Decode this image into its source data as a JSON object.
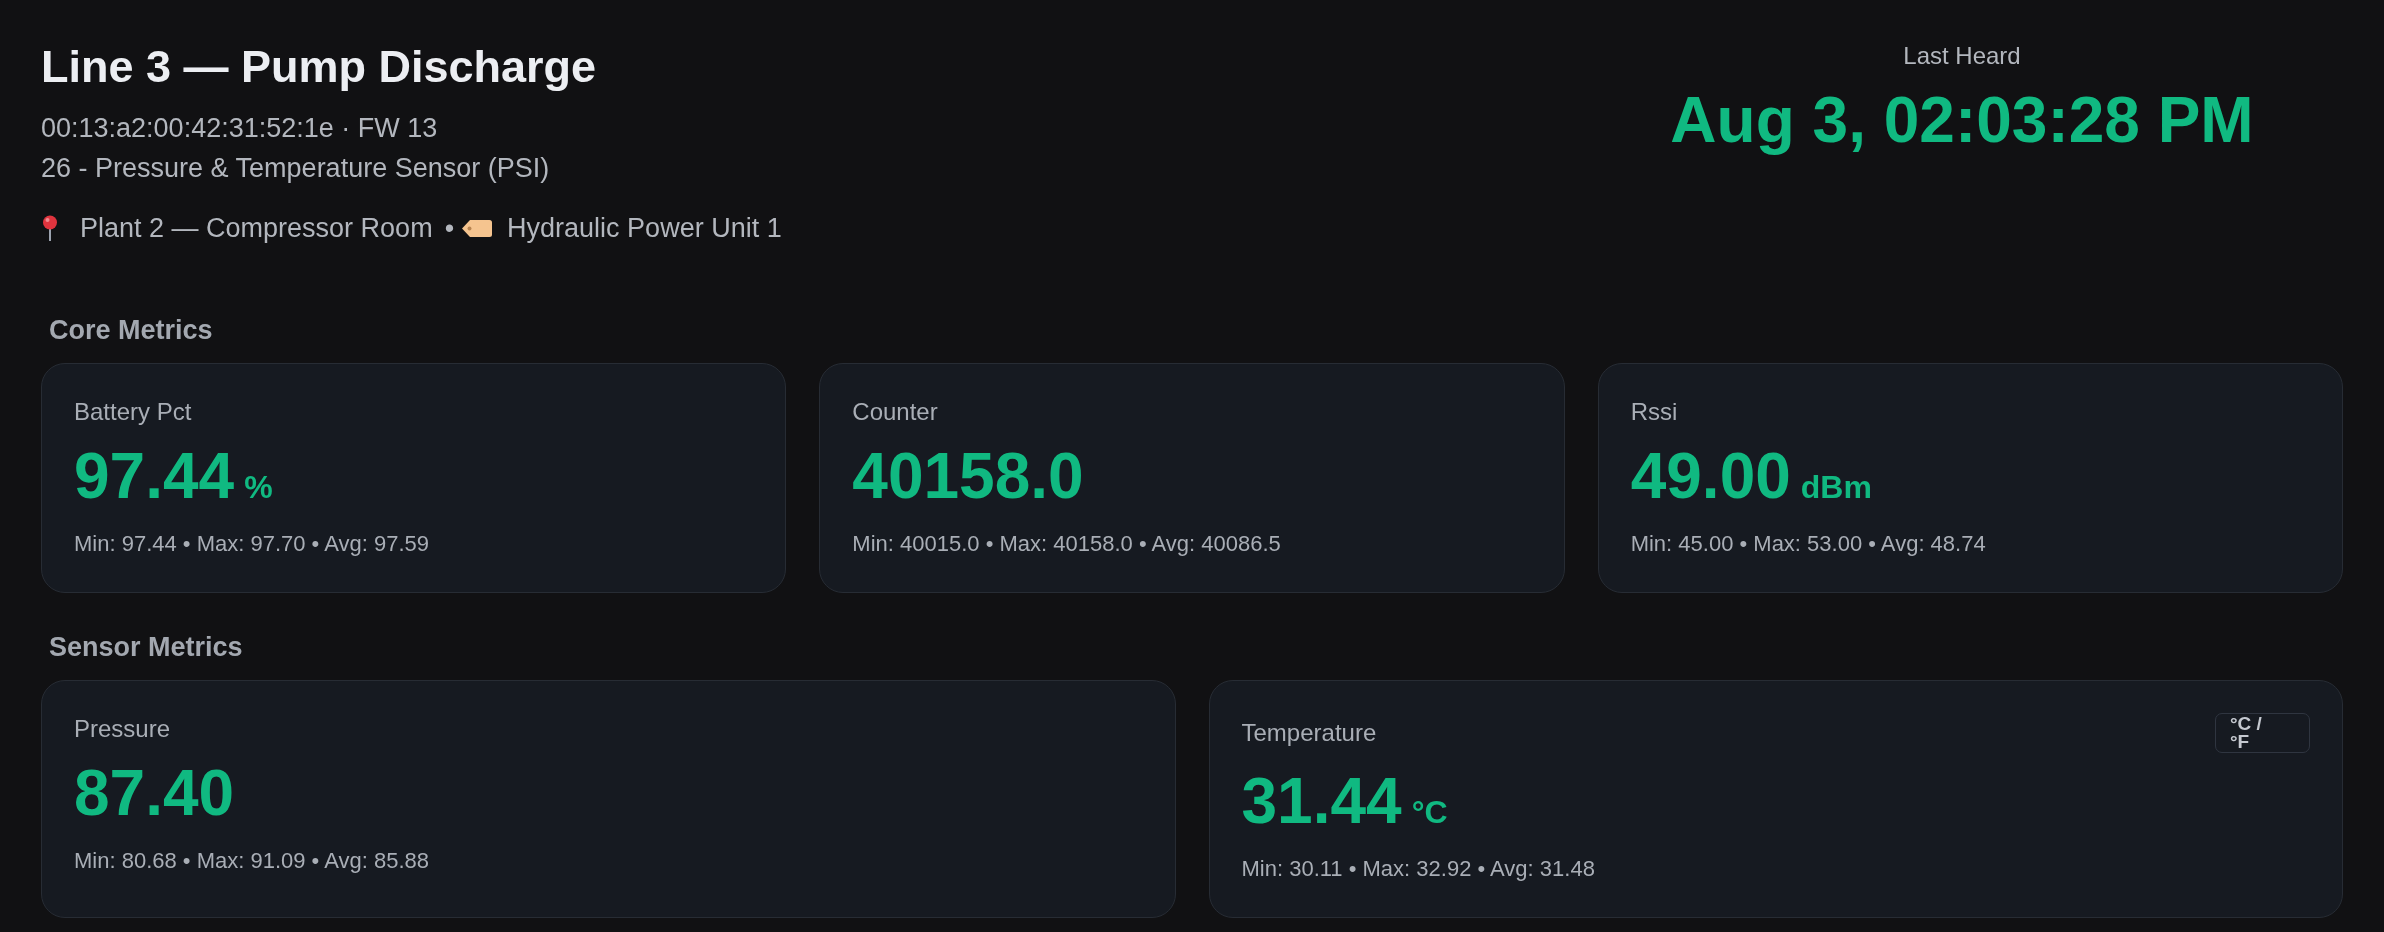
{
  "header": {
    "title": "Line 3 — Pump Discharge",
    "device_info": "00:13:a2:00:42:31:52:1e · FW 13",
    "device_type": "26 - Pressure & Temperature Sensor (PSI)",
    "location": "Plant 2 — Compressor Room",
    "separator": "•",
    "asset": "Hydraulic Power Unit 1"
  },
  "last_heard": {
    "label": "Last Heard",
    "value": "Aug 3, 02:03:28 PM"
  },
  "sections": [
    {
      "title": "Core Metrics",
      "metrics": [
        {
          "label": "Battery Pct",
          "value": "97.44",
          "unit": "%",
          "stats": "Min: 97.44 • Max: 97.70 • Avg: 97.59"
        },
        {
          "label": "Counter",
          "value": "40158.0",
          "stats": "Min: 40015.0 • Max: 40158.0 • Avg: 40086.5"
        },
        {
          "label": "Rssi",
          "value": "49.00",
          "unit": "dBm",
          "stats": "Min: 45.00 • Max: 53.00 • Avg: 48.74"
        }
      ]
    },
    {
      "title": "Sensor Metrics",
      "metrics": [
        {
          "label": "Pressure",
          "value": "87.40",
          "stats": "Min: 80.68 • Max: 91.09 • Avg: 85.88"
        },
        {
          "label": "Temperature",
          "value": "31.44",
          "unit": "°C",
          "stats": "Min: 30.11 • Max: 32.92 • Avg: 31.48",
          "toggle": "°C / °F"
        }
      ]
    }
  ]
}
